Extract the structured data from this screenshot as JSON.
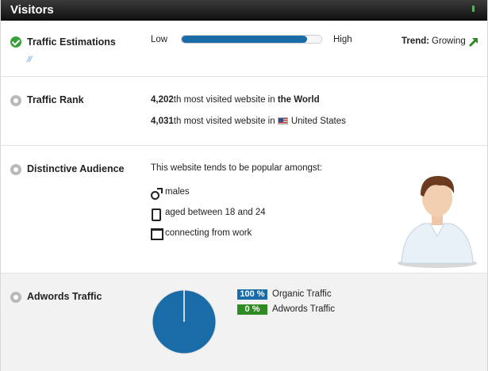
{
  "header": {
    "title": "Visitors"
  },
  "traffic_estimations": {
    "title": "Traffic Estimations",
    "low_label": "Low",
    "high_label": "High",
    "level": 0.9,
    "trend_label": "Trend:",
    "trend_value": "Growing",
    "hatch": "///"
  },
  "traffic_rank": {
    "title": "Traffic Rank",
    "world_rank": "4,202",
    "world_suffix": "th most visited website in ",
    "world_label": "the World",
    "country_rank": "4,031",
    "country_suffix": "th most visited website in ",
    "country_label": "United States"
  },
  "distinctive_audience": {
    "title": "Distinctive Audience",
    "intro": "This website tends to be popular amongst:",
    "gender": "males",
    "age": "aged between 18 and 24",
    "location": "connecting from work"
  },
  "adwords_traffic": {
    "title": "Adwords Traffic",
    "organic_pct_label": "100 %",
    "organic_label": "Organic Traffic",
    "adwords_pct_label": "0 %",
    "adwords_label": "Adwords Traffic",
    "organic_share": 100,
    "adwords_share": 0
  },
  "colors": {
    "accent_blue": "#1a6ca8",
    "accent_green": "#2e8b22",
    "check_green": "#3aa03a"
  }
}
